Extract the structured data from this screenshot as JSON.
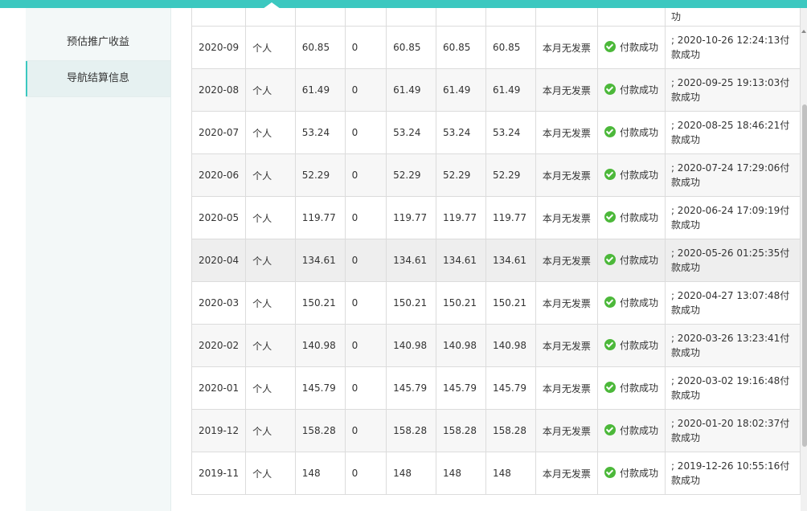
{
  "sidebar": {
    "items": [
      {
        "label": "预估推广收益",
        "active": false
      },
      {
        "label": "导航结算信息",
        "active": true
      }
    ]
  },
  "table": {
    "partial_top_remark": "功",
    "rows": [
      {
        "month": "2020-09",
        "type": "个人",
        "c1": "60.85",
        "c2": "0",
        "c3": "60.85",
        "c4": "60.85",
        "c5": "60.85",
        "invoice": "本月无发票",
        "status": "付款成功",
        "remark": "; 2020-10-26 12:24:13付款成功"
      },
      {
        "month": "2020-08",
        "type": "个人",
        "c1": "61.49",
        "c2": "0",
        "c3": "61.49",
        "c4": "61.49",
        "c5": "61.49",
        "invoice": "本月无发票",
        "status": "付款成功",
        "remark": "; 2020-09-25 19:13:03付款成功"
      },
      {
        "month": "2020-07",
        "type": "个人",
        "c1": "53.24",
        "c2": "0",
        "c3": "53.24",
        "c4": "53.24",
        "c5": "53.24",
        "invoice": "本月无发票",
        "status": "付款成功",
        "remark": "; 2020-08-25 18:46:21付款成功"
      },
      {
        "month": "2020-06",
        "type": "个人",
        "c1": "52.29",
        "c2": "0",
        "c3": "52.29",
        "c4": "52.29",
        "c5": "52.29",
        "invoice": "本月无发票",
        "status": "付款成功",
        "remark": "; 2020-07-24 17:29:06付款成功"
      },
      {
        "month": "2020-05",
        "type": "个人",
        "c1": "119.77",
        "c2": "0",
        "c3": "119.77",
        "c4": "119.77",
        "c5": "119.77",
        "invoice": "本月无发票",
        "status": "付款成功",
        "remark": "; 2020-06-24 17:09:19付款成功"
      },
      {
        "month": "2020-04",
        "type": "个人",
        "c1": "134.61",
        "c2": "0",
        "c3": "134.61",
        "c4": "134.61",
        "c5": "134.61",
        "invoice": "本月无发票",
        "status": "付款成功",
        "remark": "; 2020-05-26 01:25:35付款成功"
      },
      {
        "month": "2020-03",
        "type": "个人",
        "c1": "150.21",
        "c2": "0",
        "c3": "150.21",
        "c4": "150.21",
        "c5": "150.21",
        "invoice": "本月无发票",
        "status": "付款成功",
        "remark": "; 2020-04-27 13:07:48付款成功"
      },
      {
        "month": "2020-02",
        "type": "个人",
        "c1": "140.98",
        "c2": "0",
        "c3": "140.98",
        "c4": "140.98",
        "c5": "140.98",
        "invoice": "本月无发票",
        "status": "付款成功",
        "remark": "; 2020-03-26 13:23:41付款成功"
      },
      {
        "month": "2020-01",
        "type": "个人",
        "c1": "145.79",
        "c2": "0",
        "c3": "145.79",
        "c4": "145.79",
        "c5": "145.79",
        "invoice": "本月无发票",
        "status": "付款成功",
        "remark": "; 2020-03-02 19:16:48付款成功"
      },
      {
        "month": "2019-12",
        "type": "个人",
        "c1": "158.28",
        "c2": "0",
        "c3": "158.28",
        "c4": "158.28",
        "c5": "158.28",
        "invoice": "本月无发票",
        "status": "付款成功",
        "remark": "; 2020-01-20 18:02:37付款成功"
      },
      {
        "month": "2019-11",
        "type": "个人",
        "c1": "148",
        "c2": "0",
        "c3": "148",
        "c4": "148",
        "c5": "148",
        "invoice": "本月无发票",
        "status": "付款成功",
        "remark": "; 2019-12-26 10:55:16付款成功"
      }
    ]
  },
  "colors": {
    "accent": "#3cc8c0",
    "success": "#4cb83a",
    "sidebar_bg": "#f3f8f8"
  },
  "icons": {
    "status": "check-circle-icon",
    "scroll_up": "arrow-up-icon"
  }
}
